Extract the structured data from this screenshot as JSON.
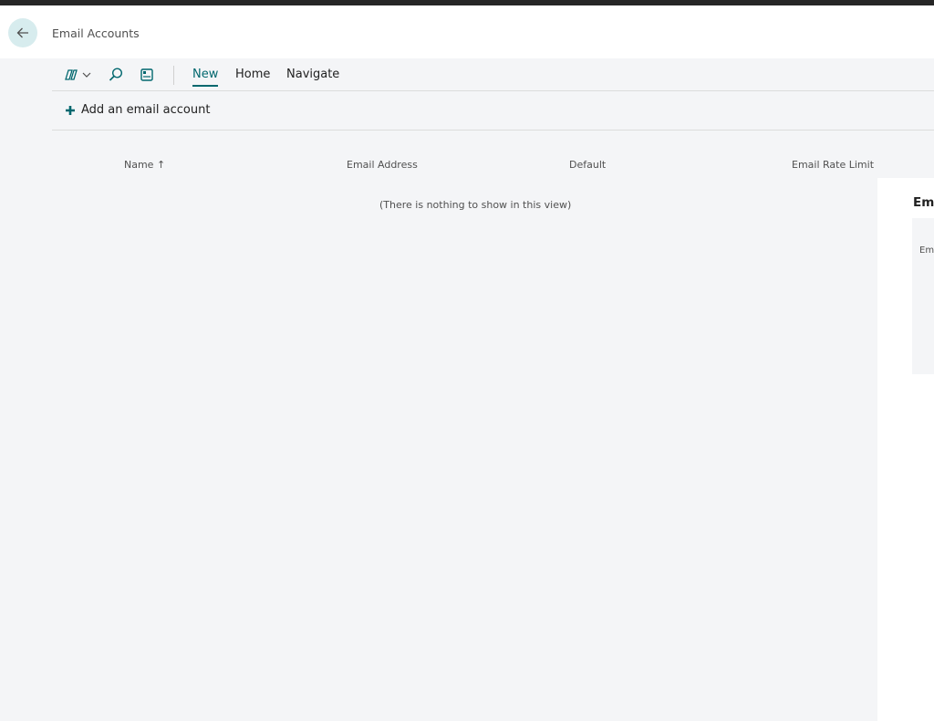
{
  "header": {
    "title": "Email Accounts"
  },
  "actionbar": {
    "menu": [
      {
        "label": "New",
        "active": true
      },
      {
        "label": "Home",
        "active": false
      },
      {
        "label": "Navigate",
        "active": false
      }
    ]
  },
  "commands": {
    "add_account_label": "Add an email account"
  },
  "grid": {
    "columns": [
      {
        "label": "Name",
        "sort": "ascending"
      },
      {
        "label": "Email Address"
      },
      {
        "label": "Default"
      },
      {
        "label": "Email Rate Limit"
      }
    ],
    "sort_indicator": "↑",
    "empty_message": "(There is nothing to show in this view)"
  },
  "factbox": {
    "title": "Ema",
    "card_text": "Em"
  },
  "colors": {
    "accent": "#00676e",
    "background": "#f4f5f7",
    "topbar": "#262626"
  }
}
